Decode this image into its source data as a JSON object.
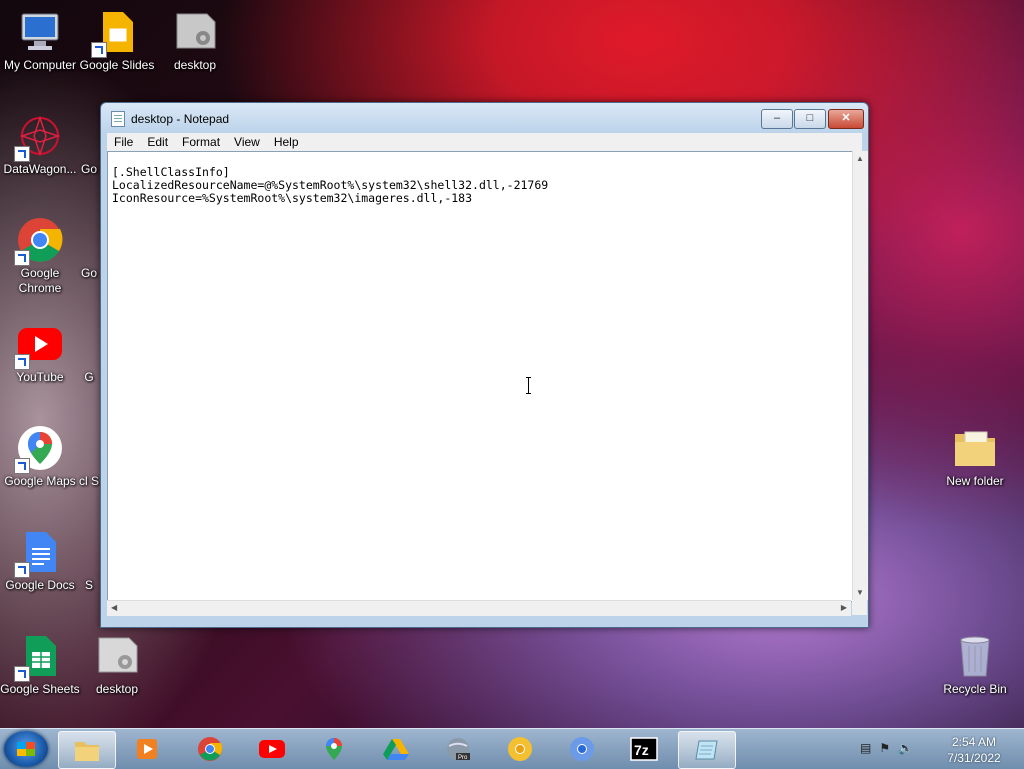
{
  "desktop": {
    "icons": [
      {
        "label": "My Computer",
        "icon": "computer-icon"
      },
      {
        "label": "Google Slides",
        "icon": "google-slides-icon"
      },
      {
        "label": "desktop",
        "icon": "settings-file-icon"
      },
      {
        "label": "DataWagon...",
        "icon": "datawagon-icon"
      },
      {
        "label": "Go",
        "icon": "google-app-icon"
      },
      {
        "label": "Google Chrome",
        "icon": "chrome-icon"
      },
      {
        "label": "Go",
        "icon": "google-app-icon"
      },
      {
        "label": "YouTube",
        "icon": "youtube-icon"
      },
      {
        "label": "G",
        "icon": "google-app-icon"
      },
      {
        "label": "Google Maps",
        "icon": "google-maps-icon"
      },
      {
        "label": "cl S",
        "icon": "google-app-icon"
      },
      {
        "label": "Google Docs",
        "icon": "google-docs-icon"
      },
      {
        "label": "S",
        "icon": "google-app-icon"
      },
      {
        "label": "Google Sheets",
        "icon": "google-sheets-icon"
      },
      {
        "label": "desktop",
        "icon": "settings-file-icon"
      },
      {
        "label": "New folder",
        "icon": "folder-icon"
      },
      {
        "label": "Recycle Bin",
        "icon": "recycle-bin-icon"
      }
    ]
  },
  "notepad": {
    "title": "desktop - Notepad",
    "menu": [
      "File",
      "Edit",
      "Format",
      "View",
      "Help"
    ],
    "content": "[.ShellClassInfo]\nLocalizedResourceName=@%SystemRoot%\\system32\\shell32.dll,-21769\nIconResource=%SystemRoot%\\system32\\imageres.dll,-183"
  },
  "taskbar": {
    "apps": [
      "file-explorer-icon",
      "media-player-icon",
      "chrome-icon",
      "youtube-icon",
      "google-maps-icon",
      "google-drive-icon",
      "google-earth-pro-icon",
      "chrome-canary-icon",
      "chromium-icon",
      "7zip-icon",
      "notepad-icon"
    ],
    "time": "2:54 AM",
    "date": "7/31/2022"
  },
  "colors": {
    "accent": "#1a5aa8",
    "youtube": "#ff0000"
  }
}
